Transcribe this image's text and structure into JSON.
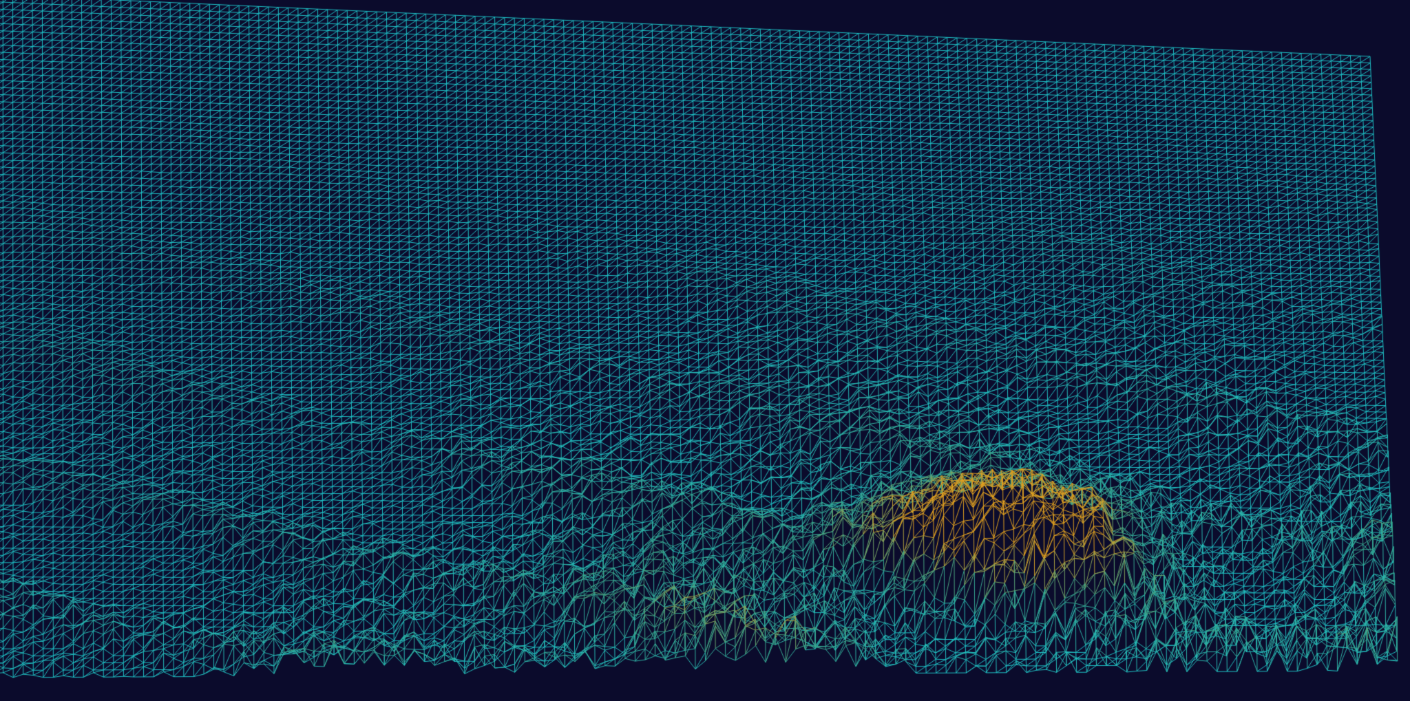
{
  "scene": {
    "type": "3d-wireframe-terrain",
    "background_color": "#0b0b2c",
    "mesh_style": "triangulated-wireframe",
    "color_ramp": {
      "low": "#1ec3c8",
      "mid": "#3aa58a",
      "high": "#e0a020"
    }
  }
}
